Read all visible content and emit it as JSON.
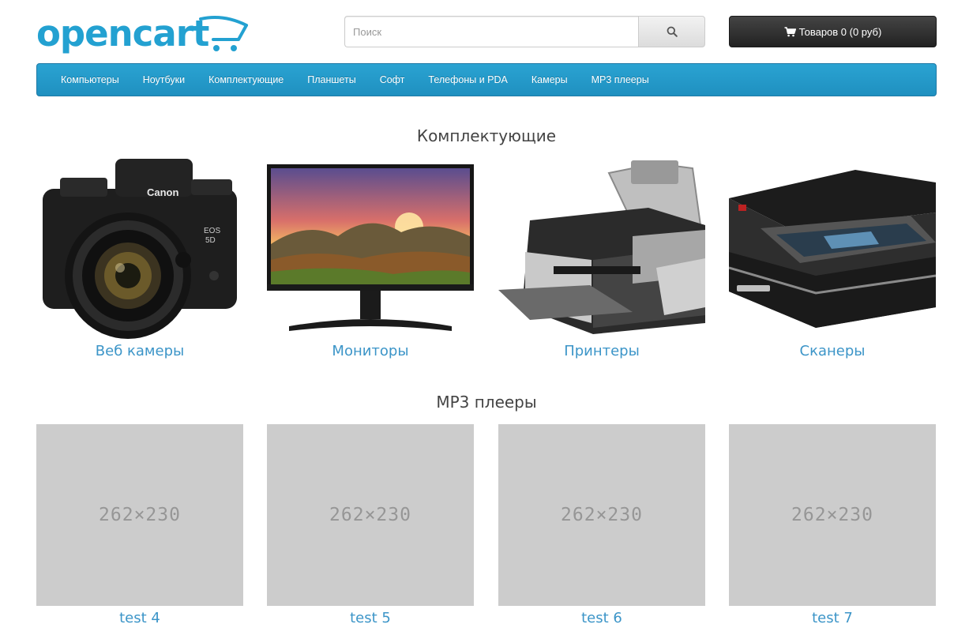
{
  "header": {
    "logo_text": "opencart",
    "search": {
      "placeholder": "Поиск",
      "value": ""
    },
    "search_icon": "search-icon",
    "cart": {
      "label": "Товаров 0 (0 руб)",
      "icon": "shopping-cart-icon"
    }
  },
  "menu": {
    "items": [
      "Компьютеры",
      "Ноутбуки",
      "Комплектующие",
      "Планшеты",
      "Софт",
      "Телефоны и PDA",
      "Камеры",
      "MP3 плееры"
    ]
  },
  "sections": [
    {
      "title": "Комплектующие",
      "items": [
        {
          "label": "Веб камеры",
          "image": "camera-image"
        },
        {
          "label": "Мониторы",
          "image": "monitor-image"
        },
        {
          "label": "Принтеры",
          "image": "printer-image"
        },
        {
          "label": "Сканеры",
          "image": "scanner-image"
        }
      ]
    },
    {
      "title": "MP3 плееры",
      "items": [
        {
          "label": "test 4",
          "placeholder": "262×230"
        },
        {
          "label": "test 5",
          "placeholder": "262×230"
        },
        {
          "label": "test 6",
          "placeholder": "262×230"
        },
        {
          "label": "test 7",
          "placeholder": "262×230"
        }
      ]
    }
  ],
  "colors": {
    "brand": "#23a1d1",
    "menu_bg": "#2aa3d2",
    "link": "#3c95c8",
    "placeholder_bg": "#cccccc"
  }
}
